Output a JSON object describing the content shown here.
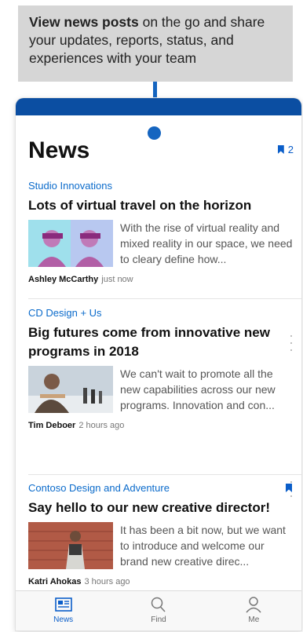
{
  "callout": {
    "bold_text": "View news posts",
    "rest_text": " on the go and share your updates, reports, status, and experiences with your team"
  },
  "header": {
    "title": "News",
    "saved_count": "2"
  },
  "posts": [
    {
      "site": "Studio Innovations",
      "headline": "Lots of virtual travel on the horizon",
      "excerpt": "With the rise of virtual reality and mixed reality in our space, we need to cleary define how...",
      "author": "Ashley McCarthy",
      "time": "just now",
      "bookmarked": false
    },
    {
      "site": "CD Design + Us",
      "headline": "Big futures come from innovative new programs in 2018",
      "excerpt": "We can't wait to promote all the new capabilities across our new programs. Innovation and con...",
      "author": "Tim Deboer",
      "time": "2 hours ago",
      "bookmarked": false
    },
    {
      "site": "Contoso Design and Adventure",
      "headline": "Say hello to our new creative director!",
      "excerpt": "It has been a bit now, but we want to introduce and welcome our brand new creative direc...",
      "author": "Katri Ahokas",
      "time": "3 hours ago",
      "bookmarked": true
    }
  ],
  "tabs": [
    {
      "label": "News",
      "icon": "news-icon",
      "active": true
    },
    {
      "label": "Find",
      "icon": "search-icon",
      "active": false
    },
    {
      "label": "Me",
      "icon": "person-icon",
      "active": false
    }
  ],
  "colors": {
    "accent": "#0b5ec9",
    "app_bar": "#0b4ea2",
    "site_link": "#0b6bcb",
    "callout_bg": "#d6d6d6"
  }
}
